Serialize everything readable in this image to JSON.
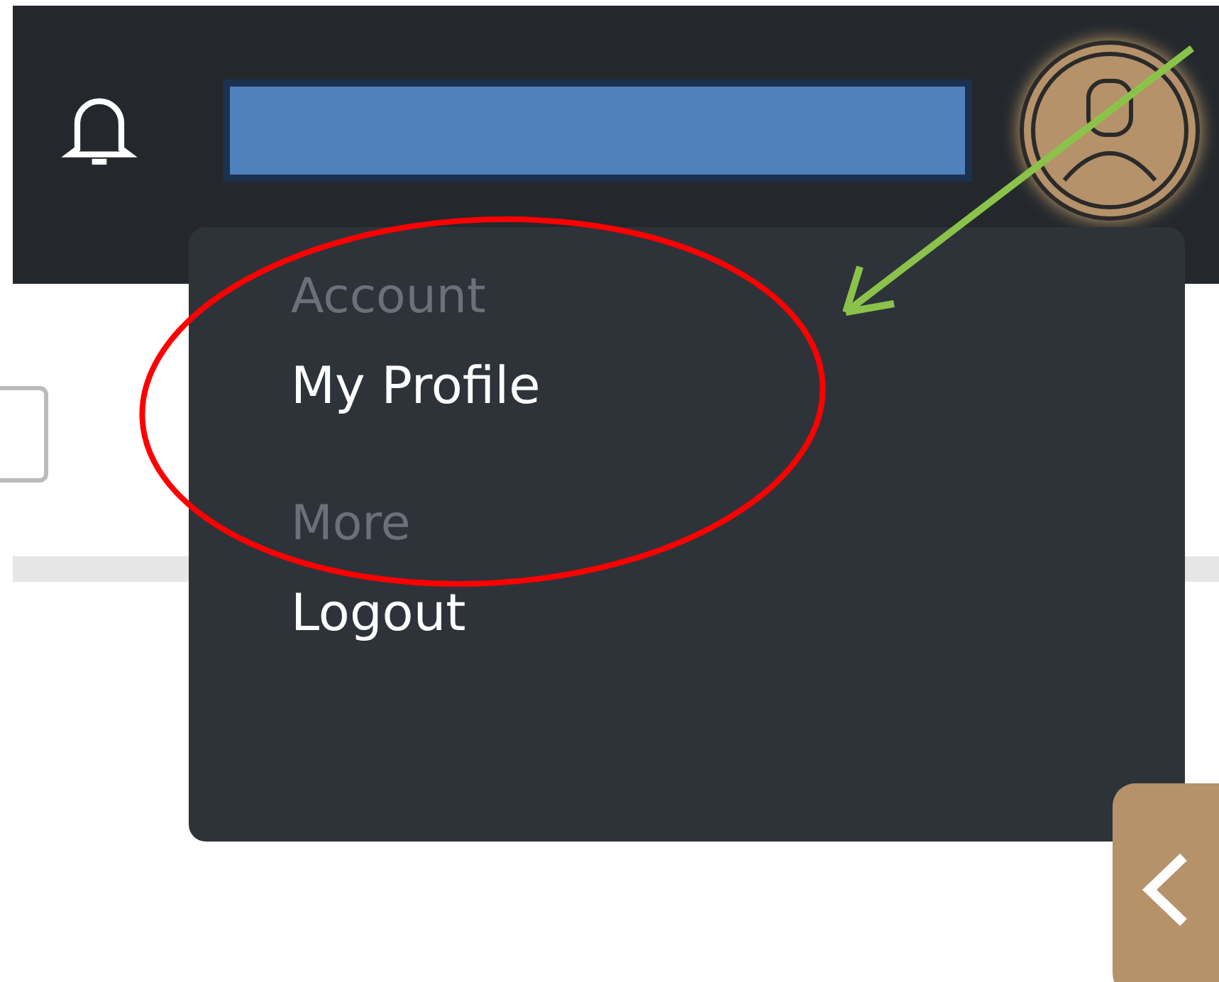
{
  "menu": {
    "items": [
      {
        "kind": "header",
        "label": "Account"
      },
      {
        "kind": "item",
        "label": "My Profile"
      },
      {
        "kind": "header",
        "label": "More"
      },
      {
        "kind": "item",
        "label": "Logout"
      }
    ]
  }
}
